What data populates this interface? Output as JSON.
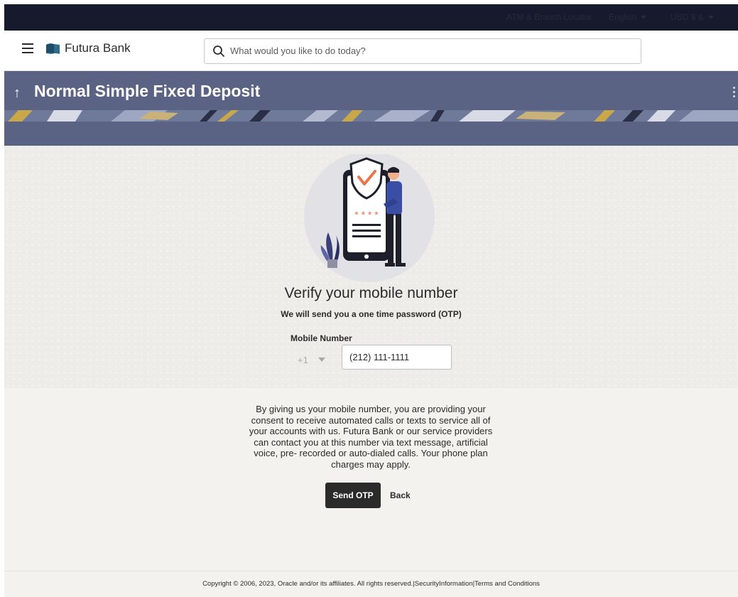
{
  "topbar": {
    "atm_branch": "ATM & Branch Locator",
    "language": "English",
    "currency": "USD $ &"
  },
  "header": {
    "brand": "Futura Bank",
    "search_placeholder": "What would you like to do today?"
  },
  "page": {
    "title": "Normal Simple Fixed Deposit"
  },
  "verify": {
    "title": "Verify your mobile number",
    "subtitle": "We will send you a one time password (OTP)",
    "mobile_label": "Mobile Number",
    "country_code": "+1",
    "mobile_value": "(212) 111-1111",
    "pin_mask": "* * * *"
  },
  "consent": {
    "text": "By giving us your mobile number, you are providing your consent to receive automated calls or texts to service all of your accounts with us. Futura Bank or our service providers can contact you at this number via text message, artificial voice, pre- recorded or auto-dialed calls. Your phone plan charges may apply."
  },
  "actions": {
    "send_otp": "Send OTP",
    "back": "Back"
  },
  "footer": {
    "copyright": "Copyright © 2006, 2023, Oracle and/or its affiliates. All rights reserved.",
    "security": "SecurityInformation",
    "terms": "Terms and Conditions",
    "separator": "|"
  },
  "colors": {
    "topbar": "#161a2c",
    "banner": "#5a6383",
    "primary_button": "#2b2b2b",
    "accent_orange": "#e8764a"
  },
  "icons": {
    "menu": "hamburger-icon",
    "logo": "bank-logo-icon",
    "search": "search-icon",
    "back": "back-arrow-icon",
    "more": "kebab-menu-icon"
  }
}
